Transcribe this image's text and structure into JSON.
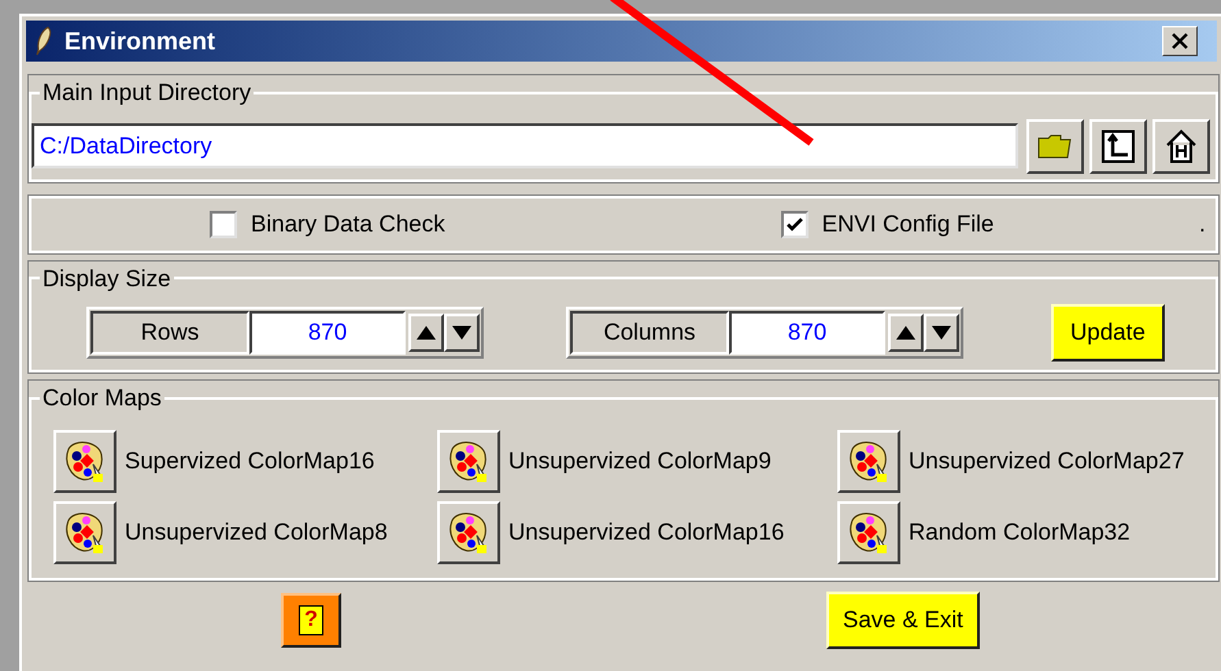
{
  "window": {
    "title": "Environment"
  },
  "main_input_directory": {
    "label": "Main Input Directory",
    "value": "C:/DataDirectory"
  },
  "options": [
    {
      "label": "Binary Data Check",
      "checked": false
    },
    {
      "label": "ENVI Config File",
      "checked": true
    }
  ],
  "options_overflow": ".",
  "display_size": {
    "label": "Display Size",
    "fields": [
      {
        "label": "Rows",
        "value": "870"
      },
      {
        "label": "Columns",
        "value": "870"
      }
    ],
    "update_button": "Update"
  },
  "color_maps": {
    "label": "Color Maps",
    "items": [
      {
        "label": "Supervized ColorMap16"
      },
      {
        "label": "Unsupervized ColorMap9"
      },
      {
        "label": "Unsupervized ColorMap27"
      },
      {
        "label": "Unsupervized ColorMap8"
      },
      {
        "label": "Unsupervized ColorMap16"
      },
      {
        "label": "Random ColorMap32"
      }
    ]
  },
  "help_button": "?",
  "save_button": "Save & Exit"
}
